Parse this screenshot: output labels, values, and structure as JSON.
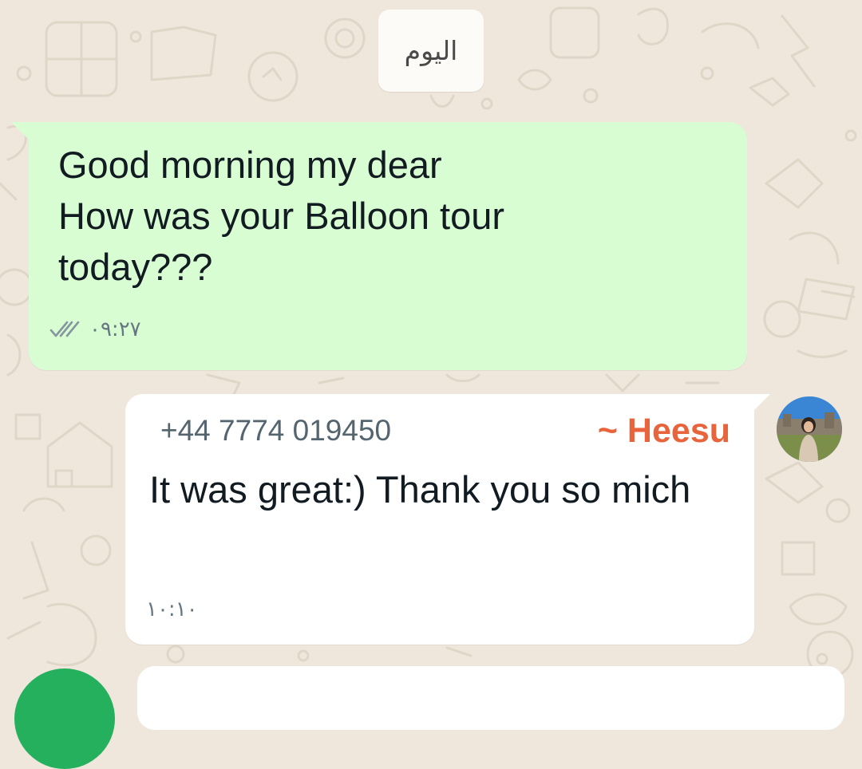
{
  "chat": {
    "date_separator": "اليوم",
    "messages": [
      {
        "direction": "outgoing",
        "text": "Good morning my dear\nHow was your Balloon tour\ntoday???",
        "time": "٠٩:٢٧",
        "status_icon": "double-check-icon"
      },
      {
        "direction": "incoming",
        "sender_phone": "+44 7774 019450",
        "sender_name": "~ Heesu",
        "text": "It was great:) Thank you so mich",
        "time": "١٠:١٠"
      }
    ]
  },
  "colors": {
    "wallpaper": "#efe7dc",
    "outgoing_bubble": "#d9fdd3",
    "incoming_bubble": "#ffffff",
    "sender_name": "#e8643c",
    "fab": "#25b05d"
  }
}
